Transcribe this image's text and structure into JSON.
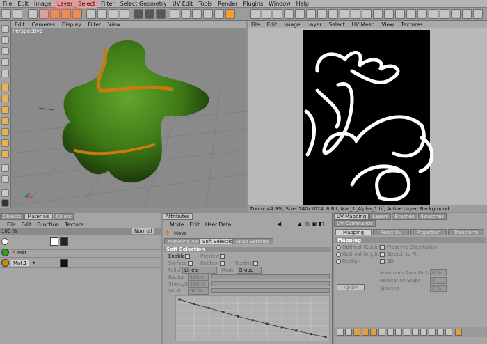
{
  "menu": [
    "File",
    "Edit",
    "Image",
    "Layer",
    "Select",
    "Filter",
    "Select Geometry",
    "UV Edit",
    "Tools",
    "Render",
    "Plugins",
    "Window",
    "Help"
  ],
  "menu_highlight": "Layer",
  "viewport": {
    "menu": [
      "Edit",
      "Cameras",
      "Display",
      "Filter",
      "View"
    ],
    "label": "Perspective"
  },
  "uv_editor": {
    "menu": [
      "File",
      "Edit",
      "Image",
      "Layer",
      "Select",
      "UV Mesh",
      "View",
      "Textures"
    ],
    "status": "Zoom: 44.9%, Size: 740x1024, 8 Bit, Mat_1_Alpha_1.tif, Active Layer: Background"
  },
  "materials": {
    "tabs": [
      "Objects",
      "Materials",
      "Colors"
    ],
    "active_tab": "Materials",
    "menu": [
      "File",
      "Edit",
      "Function",
      "Texture"
    ],
    "zoom": "100 %",
    "mode": "Normal",
    "rows": [
      {
        "name": "Mat"
      },
      {
        "name": "Mat.1"
      }
    ]
  },
  "attributes": {
    "tab": "Attributes",
    "menu": [
      "Mode",
      "Edit",
      "User Data"
    ],
    "tool": "Move",
    "subtabs": [
      "Modeling Axis",
      "Soft Selection",
      "Snap Settings"
    ],
    "active_subtab": "Soft Selection",
    "section": "Soft Selection",
    "enable": "Enable",
    "preview": "Preview",
    "surface": "Surface",
    "rubber": "Rubber",
    "restrict": "Restrict",
    "falloff_label": "Falloff",
    "falloff_value": "Linear",
    "mode_label": "Mode",
    "mode_value": "Group",
    "radius_label": "Radius",
    "radius_value": "100 m",
    "strength_label": "Strength",
    "strength_value": "100 %",
    "width_label": "Width",
    "width_value": "50 %",
    "curve": [
      [
        0,
        1
      ],
      [
        0.1,
        0.88
      ],
      [
        0.2,
        0.77
      ],
      [
        0.3,
        0.66
      ],
      [
        0.4,
        0.55
      ],
      [
        0.5,
        0.45
      ],
      [
        0.6,
        0.35
      ],
      [
        0.7,
        0.26
      ],
      [
        0.8,
        0.17
      ],
      [
        0.9,
        0.08
      ],
      [
        1,
        0
      ]
    ]
  },
  "uv_panel": {
    "tabs": [
      "UV Mapping",
      "Layers",
      "Brushes",
      "Swatches",
      "UV Commands"
    ],
    "active_tab": "UV Mapping",
    "subtabs": [
      "Mapping",
      "Relax UV",
      "Projection",
      "Transform"
    ],
    "active_subtab": "Mapping",
    "section": "Mapping",
    "opt_cubic": "Optimal (Cubic)",
    "opt_angle": "Optimal (Angle)",
    "realign": "Realign",
    "preserve": "Preserve Orientation",
    "stretch": "Stretch to Fit",
    "threed": "3D",
    "area_label": "Maximum Area Factor",
    "area_value": "0 %",
    "relax_label": "Relaxation Steps",
    "relax_value": "0",
    "spacing_label": "Spacing",
    "spacing_value": "2 %",
    "apply": "Apply"
  },
  "colors": {
    "object_green": "#3d7a16",
    "object_orange": "#c97a10",
    "uv_black": "#000000",
    "uv_white": "#ffffff",
    "highlight": "#e67878"
  }
}
